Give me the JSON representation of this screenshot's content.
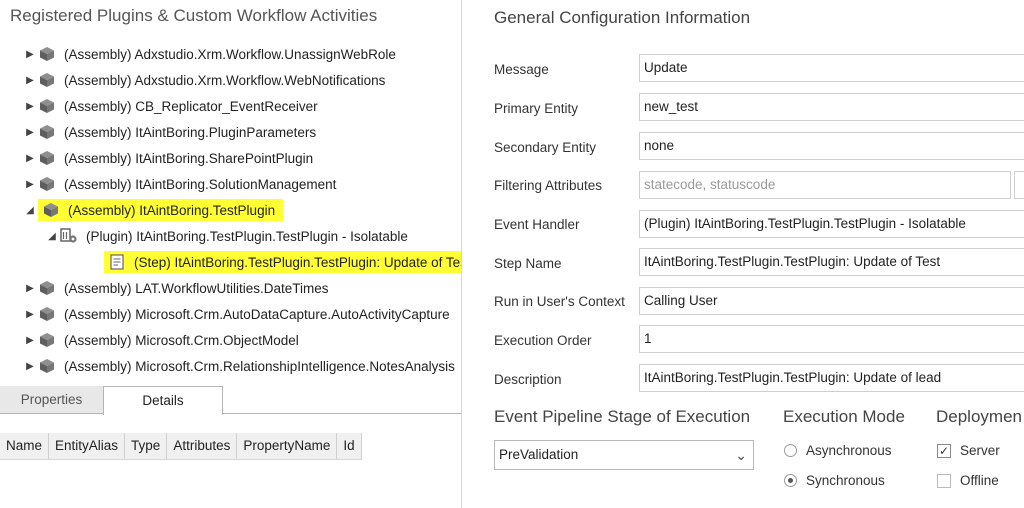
{
  "left_panel": {
    "title": "Registered Plugins & Custom Workflow Activities",
    "tree": [
      {
        "arrow": "▶",
        "label": "(Assembly) Adxstudio.Xrm.Workflow.UnassignWebRole",
        "icon": "assembly-icon"
      },
      {
        "arrow": "▶",
        "label": "(Assembly) Adxstudio.Xrm.Workflow.WebNotifications",
        "icon": "assembly-icon"
      },
      {
        "arrow": "▶",
        "label": "(Assembly) CB_Replicator_EventReceiver",
        "icon": "assembly-icon"
      },
      {
        "arrow": "▶",
        "label": "(Assembly) ItAintBoring.PluginParameters",
        "icon": "assembly-icon"
      },
      {
        "arrow": "▶",
        "label": "(Assembly) ItAintBoring.SharePointPlugin",
        "icon": "assembly-icon"
      },
      {
        "arrow": "▶",
        "label": "(Assembly) ItAintBoring.SolutionManagement",
        "icon": "assembly-icon"
      },
      {
        "arrow": "◢",
        "label": "(Assembly) ItAintBoring.TestPlugin",
        "icon": "assembly-icon",
        "highlight": true
      },
      {
        "arrow": "◢",
        "label": "(Plugin) ItAintBoring.TestPlugin.TestPlugin - Isolatable",
        "icon": "plugin-icon"
      },
      {
        "arrow": "",
        "label": "(Step) ItAintBoring.TestPlugin.TestPlugin: Update of Test",
        "icon": "step-icon",
        "highlight": true
      },
      {
        "arrow": "▶",
        "label": "(Assembly) LAT.WorkflowUtilities.DateTimes",
        "icon": "assembly-icon"
      },
      {
        "arrow": "▶",
        "label": "(Assembly) Microsoft.Crm.AutoDataCapture.AutoActivityCapture",
        "icon": "assembly-icon"
      },
      {
        "arrow": "▶",
        "label": "(Assembly) Microsoft.Crm.ObjectModel",
        "icon": "assembly-icon"
      },
      {
        "arrow": "▶",
        "label": "(Assembly) Microsoft.Crm.RelationshipIntelligence.NotesAnalysis",
        "icon": "assembly-icon"
      }
    ],
    "tabs": [
      "Properties",
      "Details"
    ],
    "grid_columns": [
      "Name",
      "EntityAlias",
      "Type",
      "Attributes",
      "PropertyName",
      "Id"
    ]
  },
  "config": {
    "title": "General Configuration Information",
    "fields": [
      {
        "label": "Message",
        "value": "Update"
      },
      {
        "label": "Primary Entity",
        "value": "new_test"
      },
      {
        "label": "Secondary Entity",
        "value": "none"
      },
      {
        "label": "Filtering Attributes",
        "value": "statecode, statuscode",
        "placeholder": true
      },
      {
        "label": "Event Handler",
        "value": "(Plugin) ItAintBoring.TestPlugin.TestPlugin - Isolatable"
      },
      {
        "label": "Step Name",
        "value": "ItAintBoring.TestPlugin.TestPlugin: Update of Test"
      },
      {
        "label": "Run in User's Context",
        "value": "Calling User"
      },
      {
        "label": "Execution Order",
        "value": "1"
      },
      {
        "label": "Description",
        "value": "ItAintBoring.TestPlugin.TestPlugin: Update of lead"
      }
    ],
    "pipeline": {
      "title": "Event Pipeline Stage of Execution",
      "selected": "PreValidation"
    },
    "execution_mode": {
      "title": "Execution Mode",
      "options": [
        "Asynchronous",
        "Synchronous"
      ],
      "selected": "Synchronous"
    },
    "deployment": {
      "title": "Deploymen",
      "options": [
        "Server",
        "Offline"
      ],
      "checked": [
        "Server"
      ]
    }
  },
  "colors": {
    "highlight": "#ffff33",
    "divider": "#d6d6d6"
  }
}
